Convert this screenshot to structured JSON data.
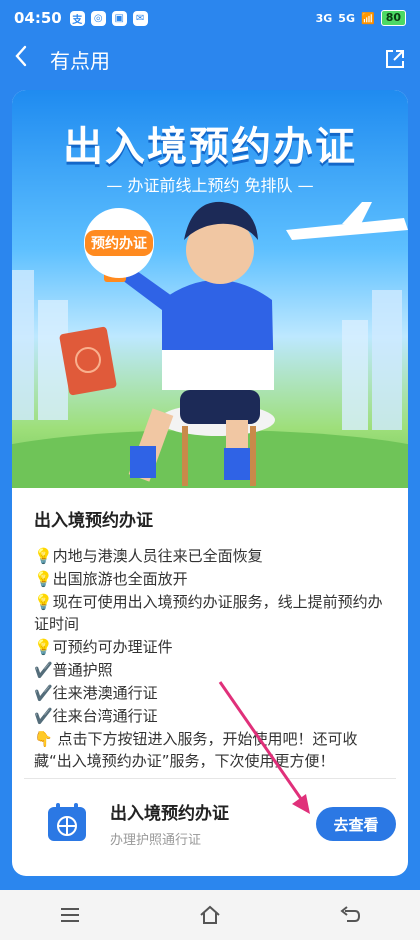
{
  "status": {
    "time": "04:50",
    "signal1": "3G",
    "signal2": "5G",
    "battery": "80"
  },
  "header": {
    "back_glyph": "<",
    "title": "有点用",
    "share_icon": "share-icon"
  },
  "banner": {
    "title": "出入境预约办证",
    "subtitle": "— 办证前线上预约 免排队 —",
    "bubble_label": "预约办证"
  },
  "article": {
    "heading": "出入境预约办证",
    "lines": [
      "💡内地与港澳人员往来已全面恢复",
      "💡出国旅游也全面放开",
      "💡现在可使用出入境预约办证服务，线上提前预约办证时间",
      "💡可预约可办理证件",
      "✔️普通护照",
      "✔️往来港澳通行证",
      "✔️往来台湾通行证",
      "👇 点击下方按钮进入服务，开始使用吧！还可收藏“出入境预约办证”服务，下次使用更方便！"
    ]
  },
  "service": {
    "title": "出入境预约办证",
    "subtitle": "办理护照通行证",
    "button_label": "去查看"
  },
  "colors": {
    "primary": "#2b86ee",
    "button": "#2b78e4",
    "arrow": "#e0307a"
  }
}
